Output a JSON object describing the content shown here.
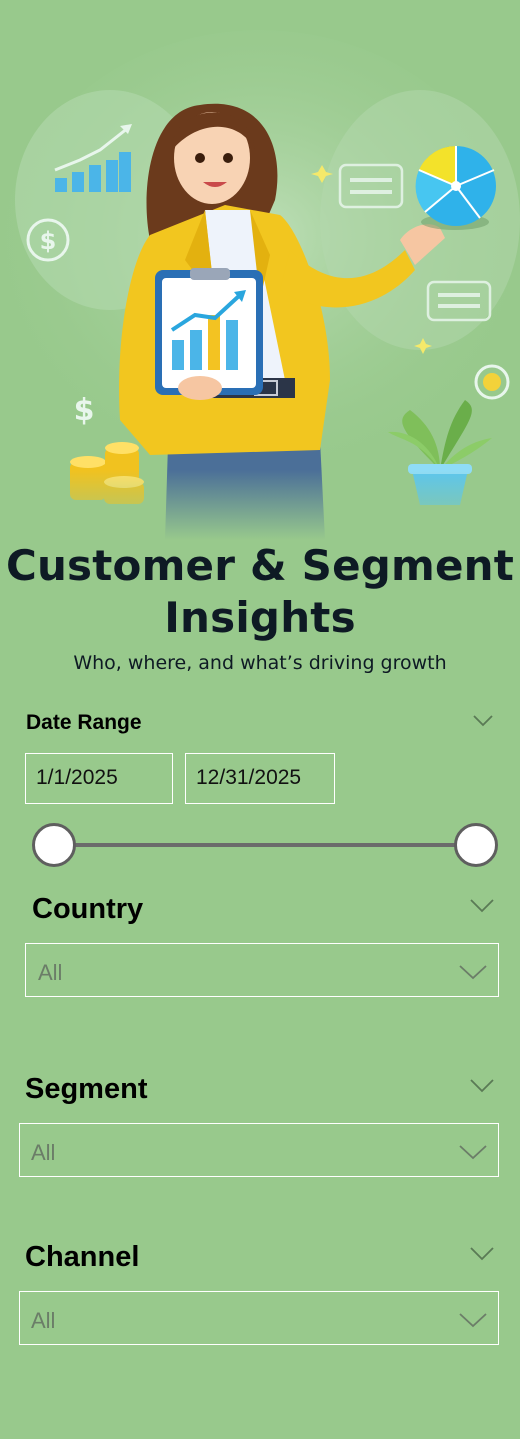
{
  "header": {
    "title_line1": "Customer & Segment",
    "title_line2": "Insights",
    "subtitle": "Who, where, and what’s driving growth"
  },
  "filters": {
    "date_range": {
      "label": "Date Range",
      "start": "1/1/2025",
      "end": "12/31/2025",
      "slider_start_fraction": 0,
      "slider_end_fraction": 1
    },
    "country": {
      "label": "Country",
      "value": "All"
    },
    "segment": {
      "label": "Segment",
      "value": "All"
    },
    "channel": {
      "label": "Channel",
      "value": "All"
    }
  },
  "illustration": {
    "coin_symbol": "$",
    "colors": {
      "jacket": "#f2c61f",
      "skirt": "#4b6f98",
      "pie_blue": "#2fb2ea",
      "pie_yellow": "#f3e22a"
    }
  }
}
